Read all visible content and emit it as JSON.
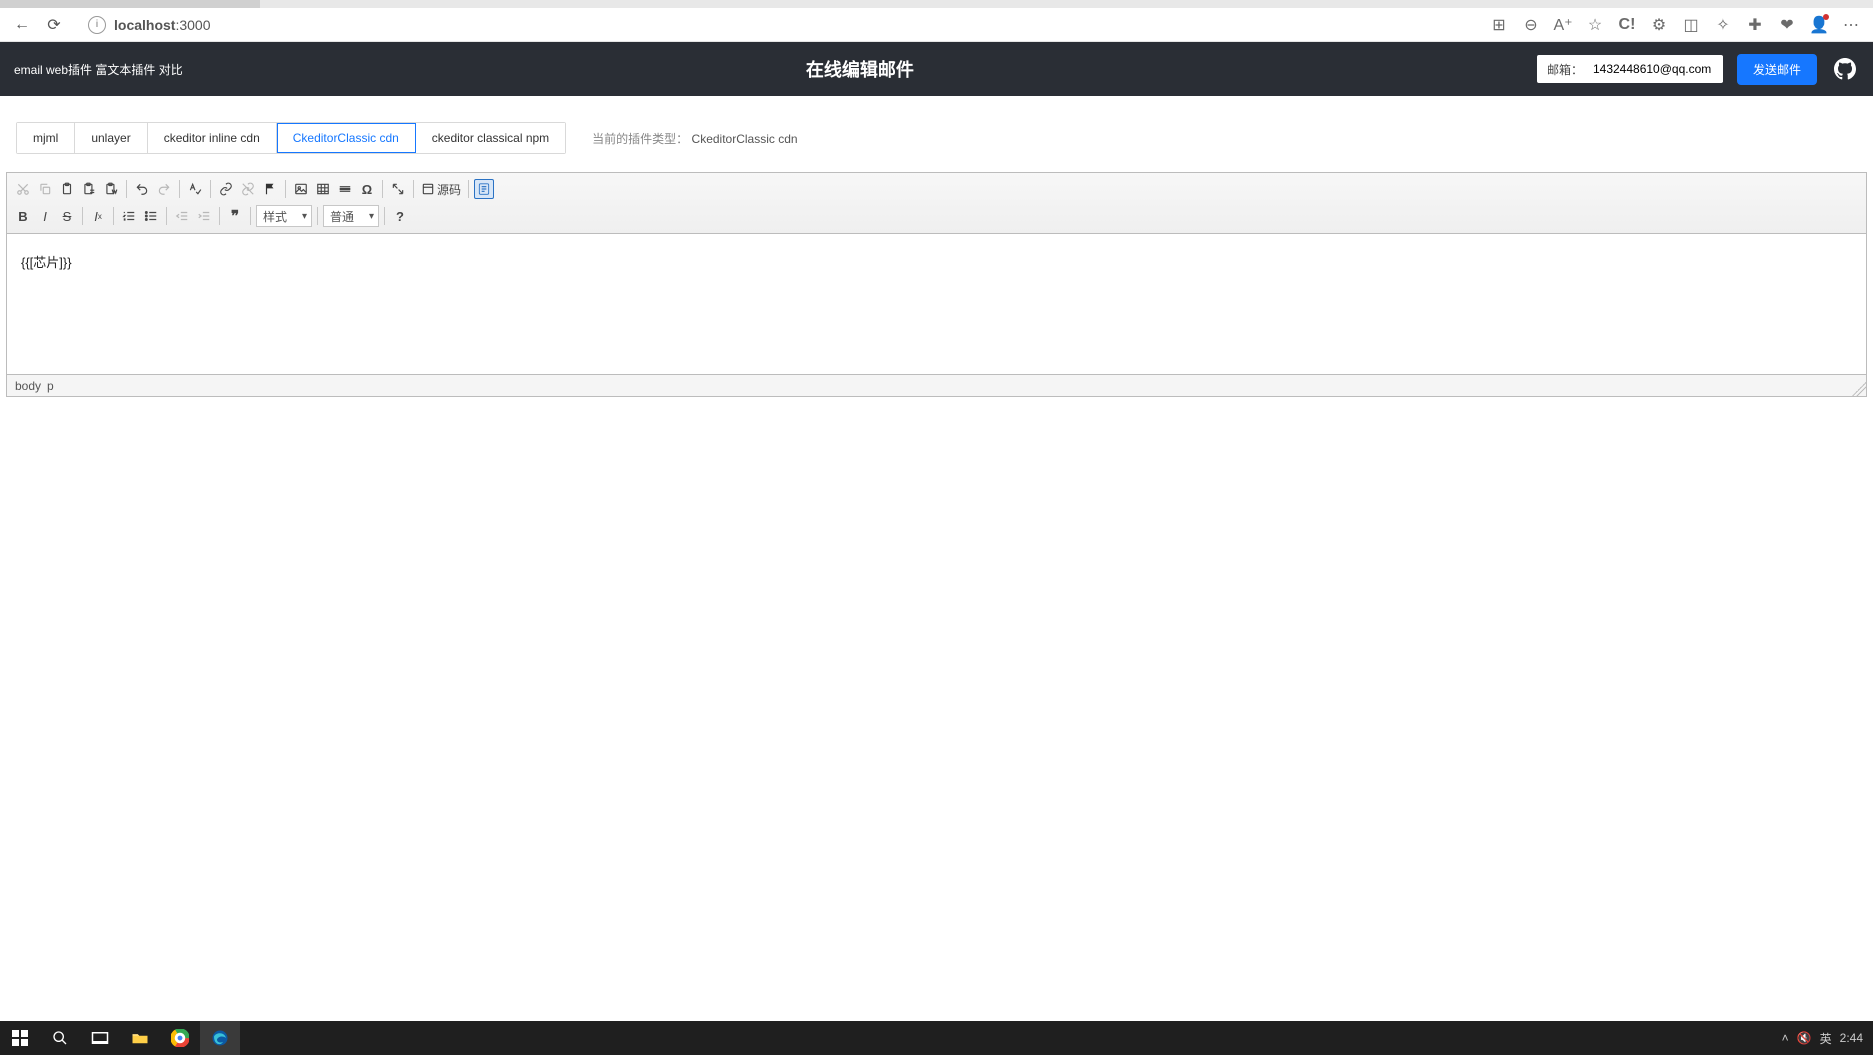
{
  "browser": {
    "url_host": "localhost",
    "url_port": ":3000"
  },
  "header": {
    "left_title": "email web插件 富文本插件 对比",
    "center_title": "在线编辑邮件",
    "email_label": "邮箱：",
    "email_value": "1432448610@qq.com",
    "send_label": "发送邮件"
  },
  "plugins": {
    "items": [
      "mjml",
      "unlayer",
      "ckeditor inline cdn",
      "CkeditorClassic cdn",
      "ckeditor classical npm"
    ],
    "active_index": 3,
    "current_label": "当前的插件类型：",
    "current_value": "CkeditorClassic cdn"
  },
  "ck": {
    "styles_label": "样式",
    "format_label": "普通",
    "source_label": "源码",
    "content": "{{[芯片]}}",
    "path_body": "body",
    "path_p": "p",
    "help": "?"
  },
  "taskbar": {
    "time": "2:44",
    "ime": "英"
  }
}
